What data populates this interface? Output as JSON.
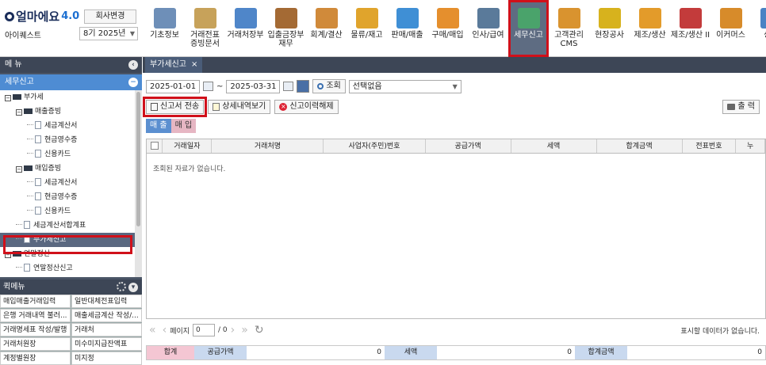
{
  "app": {
    "logo": "얼마에요",
    "version": "4.0",
    "company": "아이퀘스트",
    "change_label": "회사변경",
    "period": "8기 2025년"
  },
  "menus": [
    {
      "label": "기초정보",
      "icon": "basic-info-icon",
      "color": "#6e8fb8"
    },
    {
      "label": "거래전표\n증빙문서",
      "icon": "voucher-icon",
      "color": "#c7a25a"
    },
    {
      "label": "거래처장부",
      "icon": "ledger-icon",
      "color": "#4f86c9"
    },
    {
      "label": "입출금장부\n재무",
      "icon": "money-bag-icon",
      "color": "#a46a34"
    },
    {
      "label": "회계/결산",
      "icon": "accounting-icon",
      "color": "#d08a3a"
    },
    {
      "label": "물류/재고",
      "icon": "logistics-icon",
      "color": "#e0a42c"
    },
    {
      "label": "판매/매출",
      "icon": "sales-icon",
      "color": "#3f8fd5"
    },
    {
      "label": "구매/매입",
      "icon": "purchase-icon",
      "color": "#e58f2d"
    },
    {
      "label": "인사/급여",
      "icon": "hr-icon",
      "color": "#5a7a9a"
    },
    {
      "label": "세무신고",
      "icon": "tax-icon",
      "color": "#4aa36b",
      "selected": true
    },
    {
      "label": "고객관리\nCMS",
      "icon": "customer-icon",
      "color": "#d9932f"
    },
    {
      "label": "현장공사",
      "icon": "construction-icon",
      "color": "#d7b21d"
    },
    {
      "label": "제조/생산",
      "icon": "factory-icon",
      "color": "#e39b2a"
    },
    {
      "label": "제조/생산 II",
      "icon": "factory2-icon",
      "color": "#c33b3b"
    },
    {
      "label": "이커머스",
      "icon": "ecommerce-icon",
      "color": "#d78b2a"
    },
    {
      "label": "상점",
      "icon": "shop-icon",
      "color": "#4a83c4"
    }
  ],
  "sidebar": {
    "title": "메 뉴",
    "section": "세무신고",
    "tree": [
      {
        "label": "부가세",
        "type": "folder",
        "level": 0
      },
      {
        "label": "매출증빙",
        "type": "folder",
        "level": 1
      },
      {
        "label": "세금계산서",
        "type": "doc",
        "level": 2
      },
      {
        "label": "현금영수증",
        "type": "doc",
        "level": 2
      },
      {
        "label": "신용카드",
        "type": "doc",
        "level": 2
      },
      {
        "label": "매입증빙",
        "type": "folder",
        "level": 1
      },
      {
        "label": "세금계산서",
        "type": "doc",
        "level": 2
      },
      {
        "label": "현금영수증",
        "type": "doc",
        "level": 2
      },
      {
        "label": "신용카드",
        "type": "doc",
        "level": 2
      },
      {
        "label": "세금계산서합계표",
        "type": "doc",
        "level": 1
      },
      {
        "label": "부가세신고",
        "type": "doc",
        "level": 1,
        "selected": true
      },
      {
        "label": "연말정산",
        "type": "folder",
        "level": 0
      },
      {
        "label": "연말정산신고",
        "type": "doc",
        "level": 1
      }
    ],
    "quick_title": "퀵메뉴",
    "quick": [
      "매입매출거래입력",
      "일반대체전표입력",
      "은행 거래내역 불러...",
      "매출세금계산 작성/...",
      "거래명세표 작성/발행",
      "거래처",
      "거래처원장",
      "미수미지급잔액표",
      "계정별원장",
      "미지정"
    ]
  },
  "main": {
    "tab": "부가세신고",
    "date_from": "2025-01-01",
    "tilde": "~",
    "date_to": "2025-03-31",
    "search": "조회",
    "select": "선택없음",
    "btn_send": "신고서 전송",
    "btn_detail": "상세내역보기",
    "btn_cancel": "신고이력해제",
    "btn_print": "출 력",
    "subtab_sales": "매 출",
    "subtab_purchase": "매 입",
    "columns": [
      "거래일자",
      "거래처명",
      "사업자(주민)번호",
      "공급가액",
      "세액",
      "합계금액",
      "전표번호",
      "누"
    ],
    "empty": "조회된 자료가 없습니다.",
    "page_label": "페이지",
    "page": "0",
    "page_total": "/ 0",
    "no_data": "표시할 데이터가 없습니다.",
    "sum_label": "합계",
    "sum_supply_label": "공급가액",
    "sum_supply": "0",
    "sum_tax_label": "세액",
    "sum_tax": "0",
    "sum_total_label": "합계금액",
    "sum_total": "0"
  }
}
